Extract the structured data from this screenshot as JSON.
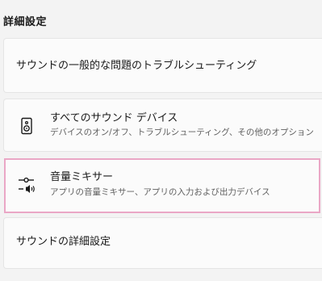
{
  "section": {
    "title": "詳細設定"
  },
  "items": {
    "troubleshoot": {
      "label": "サウンドの一般的な問題のトラブルシューティング"
    },
    "devices": {
      "icon": "speaker-device-icon",
      "title": "すべてのサウンド デバイス",
      "subtitle": "デバイスのオン/オフ、トラブルシューティング、その他のオプション"
    },
    "mixer": {
      "icon": "volume-mixer-icon",
      "title": "音量ミキサー",
      "subtitle": "アプリの音量ミキサー、アプリの入力および出力デバイス",
      "highlight_color": "#eaa7c6"
    },
    "advanced": {
      "label": "サウンドの詳細設定"
    }
  }
}
